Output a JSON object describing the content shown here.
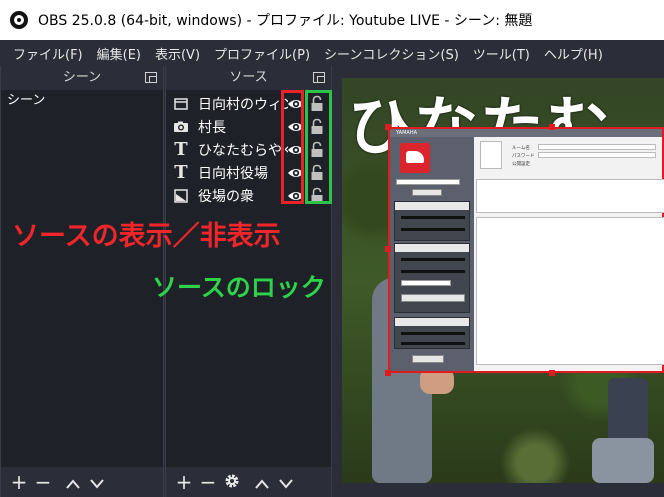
{
  "window": {
    "title": "OBS 25.0.8 (64-bit, windows) - プロファイル: Youtube LIVE - シーン: 無題"
  },
  "menu": [
    "ファイル(F)",
    "編集(E)",
    "表示(V)",
    "プロファイル(P)",
    "シーンコレクション(S)",
    "ツール(T)",
    "ヘルプ(H)"
  ],
  "scenes_dock": {
    "title": "シーン",
    "items": [
      "シーン"
    ]
  },
  "sources_dock": {
    "title": "ソース",
    "items": [
      {
        "name": "日向村のウィン",
        "icon": "window-capture-icon"
      },
      {
        "name": "村長",
        "icon": "camera-icon"
      },
      {
        "name": "ひなたむらやくば",
        "icon": "text-icon"
      },
      {
        "name": "日向村役場",
        "icon": "text-icon"
      },
      {
        "name": "役場の衆",
        "icon": "image-icon"
      }
    ]
  },
  "annotations": {
    "visibility_label": "ソースの表示／非表示",
    "lock_label": "ソースのロック"
  },
  "preview": {
    "big_text": "ひなたむ",
    "app": {
      "brand": "YAMAHA",
      "rows": [
        "ルーム名",
        "パスワード",
        "公開設定"
      ]
    }
  },
  "colors": {
    "visibility_highlight": "#e8242a",
    "lock_highlight": "#2dc24a"
  }
}
